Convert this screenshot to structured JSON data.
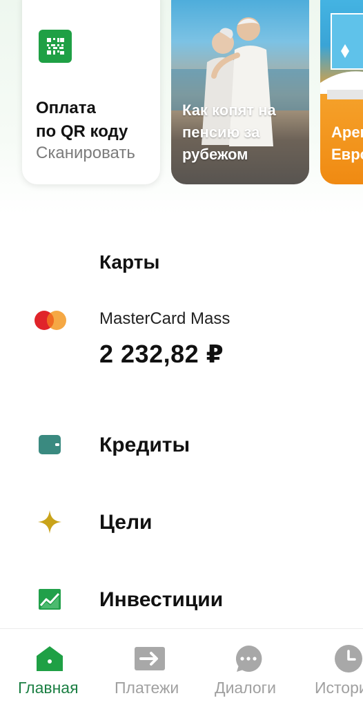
{
  "stories": {
    "qr": {
      "title_line1": "Оплата",
      "title_line2": "по QR коду",
      "subtitle": "Сканировать"
    },
    "pension": {
      "title_line1": "Как копят на",
      "title_line2": "пенсию за",
      "title_line3": "рубежом"
    },
    "rent": {
      "title_line1": "Арен",
      "title_line2": "Евро"
    }
  },
  "cards": {
    "section_title": "Карты",
    "items": [
      {
        "name": "MasterCard Mass",
        "balance": "2 232,82 ₽",
        "icon": "mastercard-logo"
      }
    ]
  },
  "menu": [
    {
      "label": "Кредиты",
      "icon": "wallet-icon",
      "color": "#3a8a80"
    },
    {
      "label": "Цели",
      "icon": "star-icon",
      "color": "#c9a31a"
    },
    {
      "label": "Инвестиции",
      "icon": "chart-icon",
      "color": "#21a04a"
    }
  ],
  "bottom_nav": [
    {
      "label": "Главная",
      "icon": "home-icon",
      "active": true
    },
    {
      "label": "Платежи",
      "icon": "payments-icon",
      "active": false
    },
    {
      "label": "Диалоги",
      "icon": "chat-icon",
      "active": false
    },
    {
      "label": "Истори",
      "icon": "clock-icon",
      "active": false
    }
  ],
  "colors": {
    "brand_green": "#1b7f43",
    "qr_green": "#1fa045",
    "inactive_gray": "#a0a0a0"
  }
}
